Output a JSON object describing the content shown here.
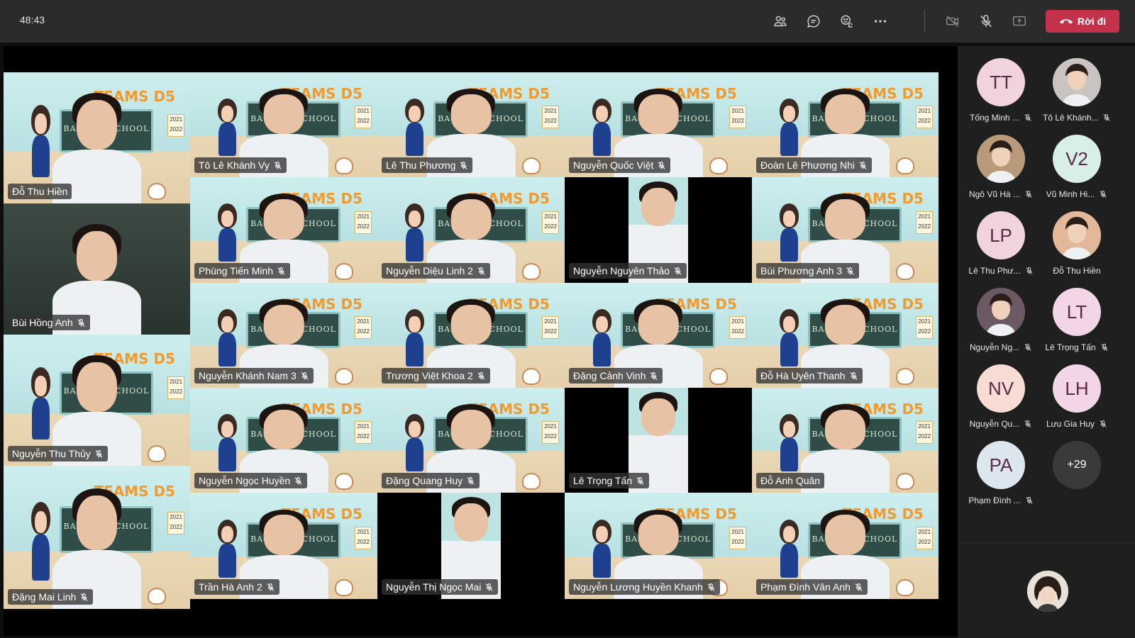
{
  "meeting": {
    "timer": "48:43",
    "leave_label": "Rời đi",
    "colors": {
      "leave": "#c4314b",
      "topbar": "#2b2b2b",
      "roster": "#1f1f1f"
    },
    "controls": [
      "people-icon",
      "chat-icon",
      "reactions-icon",
      "more-options-icon",
      "camera-off-icon",
      "mic-off-icon",
      "share-screen-icon"
    ]
  },
  "stage": {
    "background_brand": "TEAMS D5",
    "board_text": "BACK TO SCHOOL",
    "year_text": "2021 2022",
    "tiles": [
      {
        "name": "Đỗ Thu Hiền",
        "mic_off": false,
        "style": "scene"
      },
      {
        "name": "Tô Lê Khánh Vy",
        "mic_off": true,
        "style": "scene"
      },
      {
        "name": "Lê Thu Phương",
        "mic_off": true,
        "style": "scene"
      },
      {
        "name": "Nguyễn Quốc Việt",
        "mic_off": true,
        "style": "scene"
      },
      {
        "name": "Đoàn Lê Phương Nhi",
        "mic_off": true,
        "style": "scene"
      },
      {
        "name": "Bùi Hồng Anh",
        "mic_off": true,
        "style": "dark"
      },
      {
        "name": "Phùng Tiến Minh",
        "mic_off": true,
        "style": "scene"
      },
      {
        "name": "Nguyễn Diệu Linh 2",
        "mic_off": true,
        "style": "scene"
      },
      {
        "name": "Nguyễn Nguyên Thảo",
        "mic_off": true,
        "style": "black"
      },
      {
        "name": "Bùi Phương Anh 3",
        "mic_off": true,
        "style": "scene"
      },
      {
        "name": "Nguyễn Thu Thủy",
        "mic_off": true,
        "style": "scene"
      },
      {
        "name": "Nguyễn Khánh Nam 3",
        "mic_off": true,
        "style": "scene"
      },
      {
        "name": "Trương Việt Khoa 2",
        "mic_off": true,
        "style": "scene"
      },
      {
        "name": "Đặng Cảnh Vinh",
        "mic_off": true,
        "style": "scene"
      },
      {
        "name": "Đỗ Hà Uyên Thanh",
        "mic_off": true,
        "style": "scene"
      },
      {
        "name": "Nguyễn Ngọc Huyền",
        "mic_off": true,
        "style": "scene"
      },
      {
        "name": "Đặng Quang Huy",
        "mic_off": true,
        "style": "scene"
      },
      {
        "name": "Lê Trọng Tấn",
        "mic_off": true,
        "style": "black"
      },
      {
        "name": "Đỗ Anh Quân",
        "mic_off": false,
        "style": "scene"
      },
      {
        "name": "Đặng Mai Linh",
        "mic_off": true,
        "style": "scene"
      },
      {
        "name": "Trần Hà Anh 2",
        "mic_off": true,
        "style": "scene"
      },
      {
        "name": "Nguyễn Thị Ngọc Mai",
        "mic_off": true,
        "style": "black"
      },
      {
        "name": "Nguyễn Lương Huyền Khanh",
        "mic_off": true,
        "style": "scene"
      },
      {
        "name": "Phạm Đình Vân Anh",
        "mic_off": true,
        "style": "scene"
      }
    ]
  },
  "roster": {
    "items": [
      {
        "initials": "TT",
        "name": "Tống Minh ...",
        "mic_off": true,
        "avatar": "initials",
        "color": "#f1d3dd"
      },
      {
        "initials": "",
        "name": "Tô Lê Khánh...",
        "mic_off": true,
        "avatar": "photo",
        "color": "#c9c4c1"
      },
      {
        "initials": "",
        "name": "Ngô Vũ Hà ...",
        "mic_off": true,
        "avatar": "photo",
        "color": "#b89a7a"
      },
      {
        "initials": "V2",
        "name": "Vũ Minh Hi...",
        "mic_off": true,
        "avatar": "initials",
        "color": "#d9eee6"
      },
      {
        "initials": "LP",
        "name": "Lê Thu Phư...",
        "mic_off": true,
        "avatar": "initials",
        "color": "#f1d3dd"
      },
      {
        "initials": "",
        "name": "Đỗ Thu Hiền",
        "mic_off": false,
        "avatar": "photo",
        "color": "#e2b79a"
      },
      {
        "initials": "",
        "name": "Nguyễn Ng...",
        "mic_off": true,
        "avatar": "photo",
        "color": "#6b5a63"
      },
      {
        "initials": "LT",
        "name": "Lê Trọng Tấn",
        "mic_off": true,
        "avatar": "initials",
        "color": "#f2d6e8"
      },
      {
        "initials": "NV",
        "name": "Nguyễn Qu...",
        "mic_off": true,
        "avatar": "initials",
        "color": "#f6dcd2"
      },
      {
        "initials": "LH",
        "name": "Lưu Gia Huy",
        "mic_off": true,
        "avatar": "initials",
        "color": "#f2d6e8"
      },
      {
        "initials": "PA",
        "name": "Phạm Đình ...",
        "mic_off": true,
        "avatar": "initials",
        "color": "#dce6ee"
      }
    ],
    "more_count": "+29"
  }
}
